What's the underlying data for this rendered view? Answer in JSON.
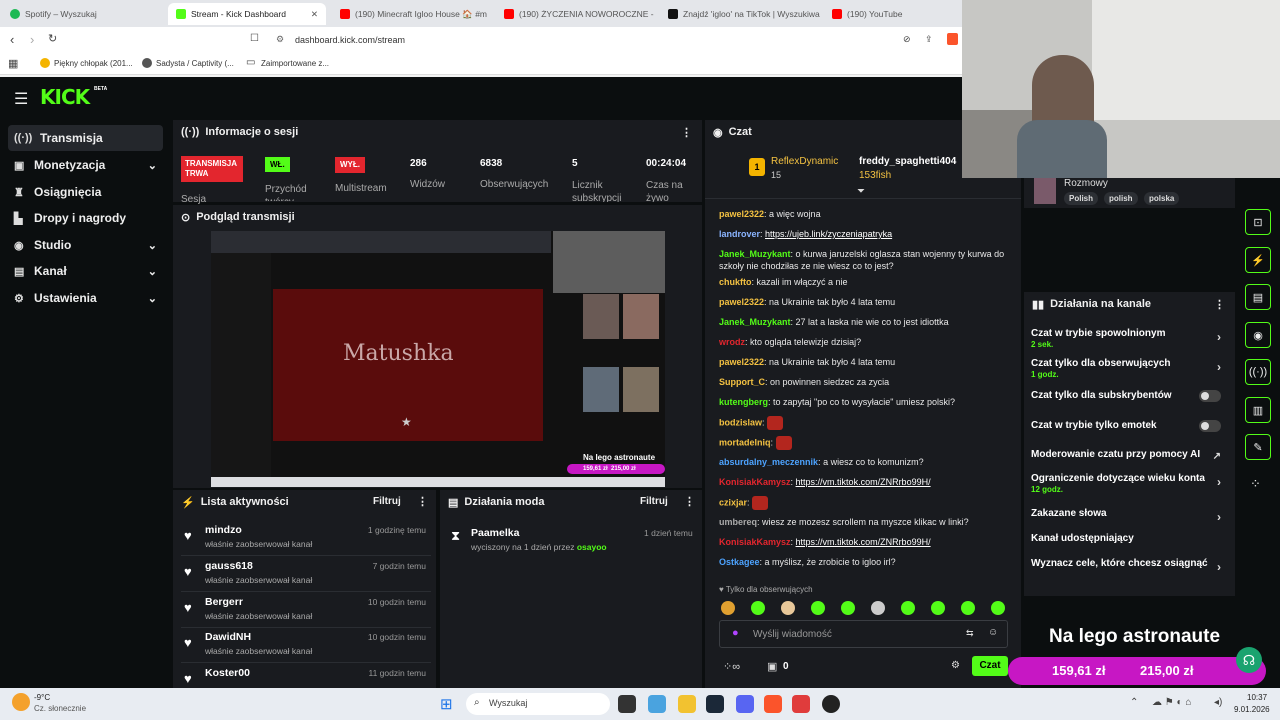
{
  "browser": {
    "tabs": [
      {
        "title": "Spotify – Wyszukaj",
        "color": "#1db954"
      },
      {
        "title": "Stream - Kick Dashboard",
        "color": "#53fc18"
      },
      {
        "title": "(190) Minecraft Igloo House 🏠 #m",
        "color": "#ff0000"
      },
      {
        "title": "(190) ŻYCZENIA NOWOROCZNE - Yo",
        "color": "#ff0000"
      },
      {
        "title": "Znajdź 'igloo' na TikTok | Wyszukiwa",
        "color": "#111111"
      },
      {
        "title": "(190) YouTube",
        "color": "#ff0000"
      }
    ],
    "url": "dashboard.kick.com/stream",
    "bookmarks": [
      "Piękny chłopak (201...",
      "Sadysta / Captivity (...",
      "Zaimportowane z..."
    ]
  },
  "kick": {
    "logo": "KICK",
    "logo_badge": "BETA",
    "sidebar": [
      {
        "label": "Transmisja",
        "icon": "broadcast-icon",
        "chevron": false,
        "selected": true
      },
      {
        "label": "Monetyzacja",
        "icon": "money-icon",
        "chevron": true
      },
      {
        "label": "Osiągnięcia",
        "icon": "trophy-icon",
        "chevron": false
      },
      {
        "label": "Dropy i nagrody",
        "icon": "drops-icon",
        "chevron": false
      },
      {
        "label": "Studio",
        "icon": "studio-icon",
        "chevron": true
      },
      {
        "label": "Kanał",
        "icon": "channel-icon",
        "chevron": true
      },
      {
        "label": "Ustawienia",
        "icon": "gear-icon",
        "chevron": true
      }
    ],
    "session": {
      "title": "Informacje o sesji",
      "live_badge": "TRANSMISJA TRWA",
      "live_label": "Sesja",
      "tips_badge": "WŁ.",
      "tips_label": "Przychód twórcy",
      "multistream_badge": "WYŁ.",
      "multistream_label": "Multistream",
      "viewers": "286",
      "viewers_label": "Widzów",
      "followers": "6838",
      "followers_label": "Obserwujących",
      "subs": "5",
      "subs_label": "Licznik subskrypcji",
      "time": "00:24:04",
      "time_label": "Czas na żywo"
    },
    "preview": {
      "title": "Podgląd transmisji",
      "overlay_text": "Na lego astronaute",
      "amount_left": "159,61 zł",
      "amount_right": "215,00 zł",
      "video_title": "Matushka"
    },
    "activity": {
      "title": "Lista aktywności",
      "filter": "Filtruj",
      "items": [
        {
          "name": "mindzo",
          "desc": "właśnie zaobserwował kanał",
          "time": "1 godzinę temu"
        },
        {
          "name": "gauss618",
          "desc": "właśnie zaobserwował kanał",
          "time": "7 godzin temu"
        },
        {
          "name": "Bergerr",
          "desc": "właśnie zaobserwował kanał",
          "time": "10 godzin temu"
        },
        {
          "name": "DawidNH",
          "desc": "właśnie zaobserwował kanał",
          "time": "10 godzin temu"
        },
        {
          "name": "Koster00",
          "desc": "",
          "time": "11 godzin temu"
        }
      ]
    },
    "mod": {
      "title": "Działania moda",
      "filter": "Filtruj",
      "item_name": "Paamelka",
      "item_desc_prefix": "wyciszony na 1 dzień przez",
      "item_by": "osayoo",
      "item_time": "1 dzień temu"
    },
    "chat": {
      "title": "Czat",
      "top_gifter": "ReflexDynamic",
      "top_gifter_count": "15",
      "top_user": "freddy_spaghetti404",
      "top_user_sub": "153fish",
      "messages": [
        {
          "user": "pawel2322",
          "color": "#f4c242",
          "text": "a więc wojna"
        },
        {
          "user": "landrover",
          "color": "#8ab4ff",
          "text": "",
          "link": "https://ujeb.link/zyczeniapatryka"
        },
        {
          "user": "Janek_Muzykant",
          "color": "#53fc18",
          "text": "o kurwa jaruzelski oglasza stan wojenny ty kurwa do szkoły nie chodziłas ze nie wiesz co to jest?"
        },
        {
          "user": "chukfto",
          "color": "#f4c242",
          "text": "kazali im włączyć a nie"
        },
        {
          "user": "pawel2322",
          "color": "#f4c242",
          "text": "na Ukrainie tak było 4 lata temu"
        },
        {
          "user": "Janek_Muzykant",
          "color": "#53fc18",
          "text": "27 lat a laska nie wie co to jest idiottka"
        },
        {
          "user": "wrodz",
          "color": "#e3262e",
          "text": "kto ogląda telewizje dzisiaj?"
        },
        {
          "user": "pawel2322",
          "color": "#f4c242",
          "text": "na Ukrainie tak było 4 lata temu"
        },
        {
          "user": "Support_C",
          "color": "#f4c242",
          "text": "on powinnen siedzec za zycia"
        },
        {
          "user": "kutengberg",
          "color": "#53fc18",
          "text": "to zapytaj \"po co to wysyłacie\" umiesz polski?"
        },
        {
          "user": "bodzislaw",
          "color": "#f4c242",
          "text": ""
        },
        {
          "user": "mortadelniq",
          "color": "#f4c242",
          "text": ""
        },
        {
          "user": "absurdalny_meczennik",
          "color": "#4da3ff",
          "text": "a wiesz co to komunizm?"
        },
        {
          "user": "KonisiakKamysz",
          "color": "#e3262e",
          "text": "",
          "link": "https://vm.tiktok.com/ZNRrbo99H/"
        },
        {
          "user": "czixjar",
          "color": "#f4c242",
          "text": ""
        },
        {
          "user": "umbereq",
          "color": "#aaaaaa",
          "text": "wiesz ze mozesz scrollem na myszce klikac w linki?"
        },
        {
          "user": "KonisiakKamysz",
          "color": "#e3262e",
          "text": "",
          "link": "https://vm.tiktok.com/ZNRrbo99H/"
        },
        {
          "user": "Ostkagee",
          "color": "#4da3ff",
          "text": "a myślisz, że zrobicie to igloo irl?"
        }
      ],
      "followers_only": "Tylko dla obserwujących",
      "input_placeholder": "Wyślij wiadomość",
      "send_label": "Czat",
      "counter": "0"
    },
    "user_card": {
      "name": "Rozmowy",
      "tags": [
        "Polish",
        "polish",
        "polska"
      ]
    },
    "channel_actions": {
      "title": "Działania na kanale",
      "items": [
        {
          "label": "Czat w trybie spowolnionym",
          "sub": "2 sek.",
          "type": "arrow"
        },
        {
          "label": "Czat tylko dla obserwujących",
          "sub": "1 godz.",
          "type": "arrow"
        },
        {
          "label": "Czat tylko dla subskrybentów",
          "sub": "",
          "type": "toggle"
        },
        {
          "label": "Czat w trybie tylko emotek",
          "sub": "",
          "type": "toggle"
        },
        {
          "label": "Moderowanie czatu przy pomocy AI",
          "sub": "",
          "type": "external"
        },
        {
          "label": "Ograniczenie dotyczące wieku konta",
          "sub": "12 godz.",
          "type": "arrow"
        },
        {
          "label": "Zakazane słowa",
          "sub": "",
          "type": "arrow"
        },
        {
          "label": "Kanał udostępniający",
          "sub": "",
          "type": "none"
        },
        {
          "label": "Wyznacz cele, które chcesz osiągnąć",
          "sub": "",
          "type": "arrow"
        }
      ]
    }
  },
  "overlay": {
    "headline": "Na lego astronaute",
    "amount_left": "159,61 zł",
    "amount_right": "215,00 zł"
  },
  "taskbar": {
    "weather_temp": "-9°C",
    "weather_desc": "Cz. słonecznie",
    "search": "Wyszukaj",
    "time": "10:37",
    "date": "9.01.2026"
  }
}
